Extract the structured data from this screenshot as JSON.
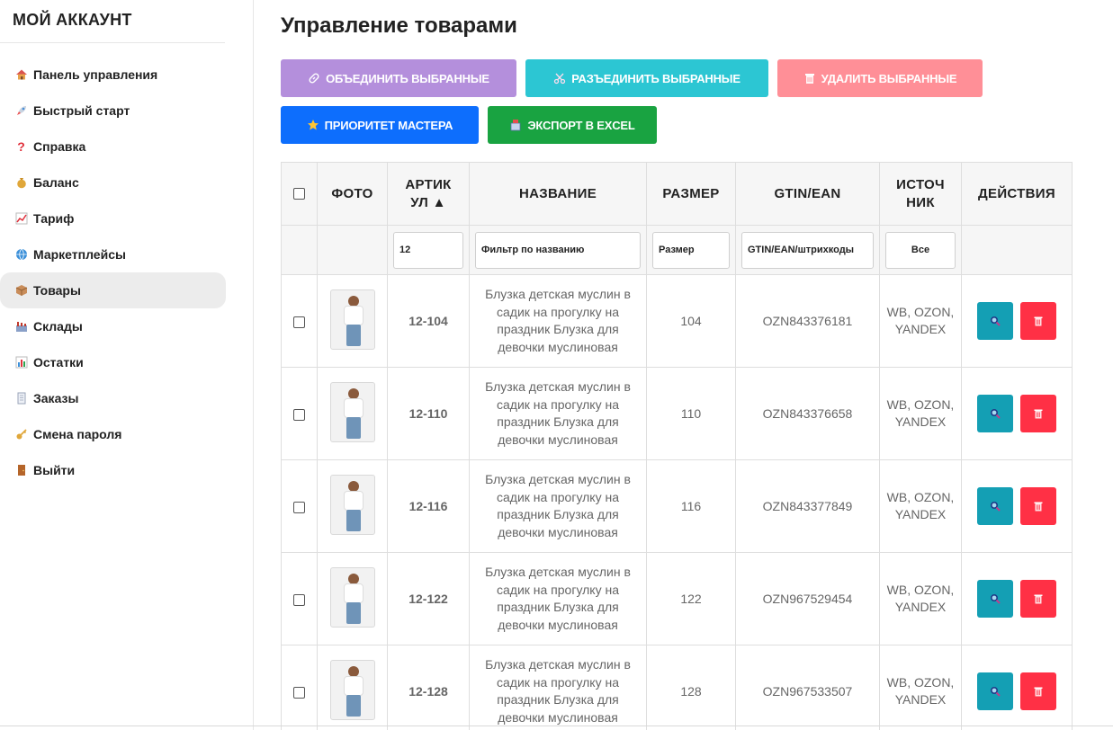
{
  "sidebar": {
    "title": "МОЙ АККАУНТ",
    "items": [
      {
        "label": "Панель управления",
        "icon": "house-icon"
      },
      {
        "label": "Быстрый старт",
        "icon": "rocket-icon"
      },
      {
        "label": "Справка",
        "icon": "question-icon"
      },
      {
        "label": "Баланс",
        "icon": "money-bag-icon"
      },
      {
        "label": "Тариф",
        "icon": "chart-up-icon"
      },
      {
        "label": "Маркетплейсы",
        "icon": "globe-icon"
      },
      {
        "label": "Товары",
        "icon": "package-icon",
        "active": true
      },
      {
        "label": "Склады",
        "icon": "factory-icon"
      },
      {
        "label": "Остатки",
        "icon": "bar-chart-icon"
      },
      {
        "label": "Заказы",
        "icon": "receipt-icon"
      },
      {
        "label": "Смена пароля",
        "icon": "key-icon"
      },
      {
        "label": "Выйти",
        "icon": "door-icon"
      }
    ]
  },
  "main": {
    "title": "Управление товарами",
    "buttons": {
      "merge": "ОБЪЕДИНИТЬ ВЫБРАННЫЕ",
      "split": "РАЗЪЕДИНИТЬ ВЫБРАННЫЕ",
      "delete": "УДАЛИТЬ ВЫБРАННЫЕ",
      "priority": "ПРИОРИТЕТ МАСТЕРА",
      "export": "ЭКСПОРТ В EXCEL"
    },
    "colors": {
      "merge": "#b48fdc",
      "split": "#2cc6d3",
      "delete": "#ff8f97",
      "priority": "#0d6efd",
      "export": "#19a341",
      "view_action": "#149fb4",
      "delete_action": "#ff3045"
    }
  },
  "table": {
    "headers": {
      "photo": "ФОТО",
      "article_line1": "АРТИК",
      "article_line2": "УЛ ▲",
      "name": "НАЗВАНИЕ",
      "size": "РАЗМЕР",
      "gtin": "GTIN/EAN",
      "source_line1": "ИСТОЧ",
      "source_line2": "НИК",
      "actions": "ДЕЙСТВИЯ"
    },
    "filters": {
      "article_value": "12",
      "name_placeholder": "Фильтр по названию",
      "size_placeholder": "Размер",
      "gtin_placeholder": "GTIN/EAN/штрихкоды",
      "source_selected": "Все"
    },
    "rows": [
      {
        "article": "12-104",
        "name": "Блузка детская муслин в садик на прогулку на праздник Блузка для девочки муслиновая",
        "size": "104",
        "gtin": "OZN843376181",
        "source": "WB, OZON, YANDEX"
      },
      {
        "article": "12-110",
        "name": "Блузка детская муслин в садик на прогулку на праздник Блузка для девочки муслиновая",
        "size": "110",
        "gtin": "OZN843376658",
        "source": "WB, OZON, YANDEX"
      },
      {
        "article": "12-116",
        "name": "Блузка детская муслин в садик на прогулку на праздник Блузка для девочки муслиновая",
        "size": "116",
        "gtin": "OZN843377849",
        "source": "WB, OZON, YANDEX"
      },
      {
        "article": "12-122",
        "name": "Блузка детская муслин в садик на прогулку на праздник Блузка для девочки муслиновая",
        "size": "122",
        "gtin": "OZN967529454",
        "source": "WB, OZON, YANDEX"
      },
      {
        "article": "12-128",
        "name": "Блузка детская муслин в садик на прогулку на праздник Блузка для девочки муслиновая",
        "size": "128",
        "gtin": "OZN967533507",
        "source": "WB, OZON, YANDEX"
      }
    ]
  }
}
